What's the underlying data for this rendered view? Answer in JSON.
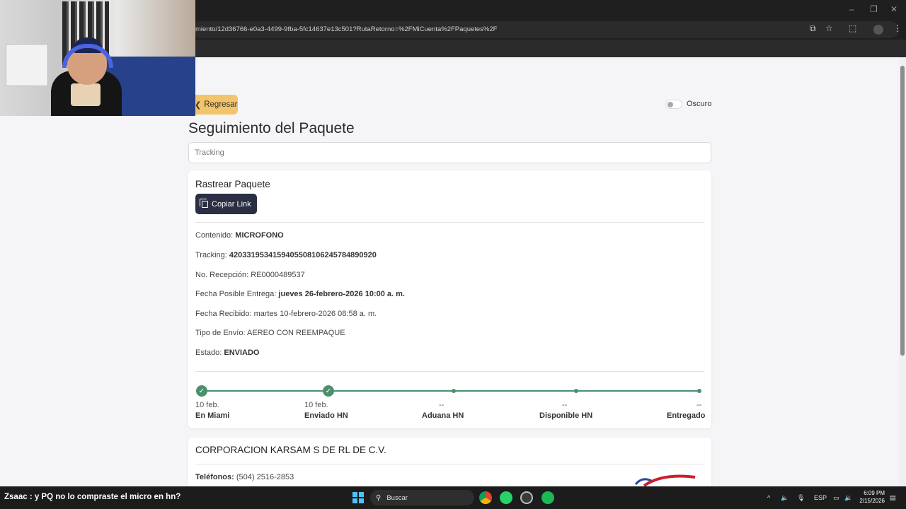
{
  "browser": {
    "url": "miento/12d36766-e0a3-4499-9fba-5fc14637e13c501?RutaRetorno=%2FMiCuenta%2FPaquetes%2F"
  },
  "header": {
    "back_label": "Regresar",
    "theme_toggle_label": "Oscuro"
  },
  "page": {
    "title": "Seguimiento del Paquete",
    "search_placeholder": "Tracking"
  },
  "track_card": {
    "title": "Rastrear Paquete",
    "copy_link_label": "Copiar Link",
    "fields": [
      {
        "label": "Contenido:",
        "value": "MICROFONO",
        "bold": true
      },
      {
        "label": "Tracking:",
        "value": "420331953415940550810624578489092​0",
        "bold": true
      },
      {
        "label": "No. Recepción:",
        "value": "RE0000489537",
        "bold": false
      },
      {
        "label": "Fecha Posible Entrega:",
        "value": "jueves 26-febrero-2026 10:00 a. m.",
        "bold": true
      },
      {
        "label": "Fecha Recibido:",
        "value": "martes 10-febrero-2026 08:58 a. m.",
        "bold": false
      },
      {
        "label": "Tipo de Envío:",
        "value": "AEREO CON REEMPAQUE",
        "bold": false
      },
      {
        "label": "Estado:",
        "value": "ENVIADO",
        "bold": true
      }
    ],
    "timeline": [
      {
        "date": "10 feb.",
        "label": "En Miami",
        "done": true
      },
      {
        "date": "10 feb.",
        "label": "Enviado HN",
        "done": true
      },
      {
        "date": "--",
        "label": "Aduana HN",
        "done": false
      },
      {
        "date": "--",
        "label": "Disponible HN",
        "done": false
      },
      {
        "date": "--",
        "label": "Entregado",
        "done": false
      }
    ]
  },
  "company_card": {
    "name": "CORPORACION KARSAM S DE RL DE C.V.",
    "phone_label": "Teléfonos:",
    "phone_value": "(504) 2516-2853"
  },
  "taskbar": {
    "chat_user": "Zsaac",
    "chat_message": "y PQ no lo compraste el micro en hn?",
    "search_label": "Buscar",
    "lang": "ESP",
    "time": "6:09 PM",
    "date": "2/15/2026"
  },
  "colors": {
    "accent_yellow": "#f2c46b",
    "dark_button": "#2a2f44",
    "timeline_green": "#4a8f6e"
  }
}
